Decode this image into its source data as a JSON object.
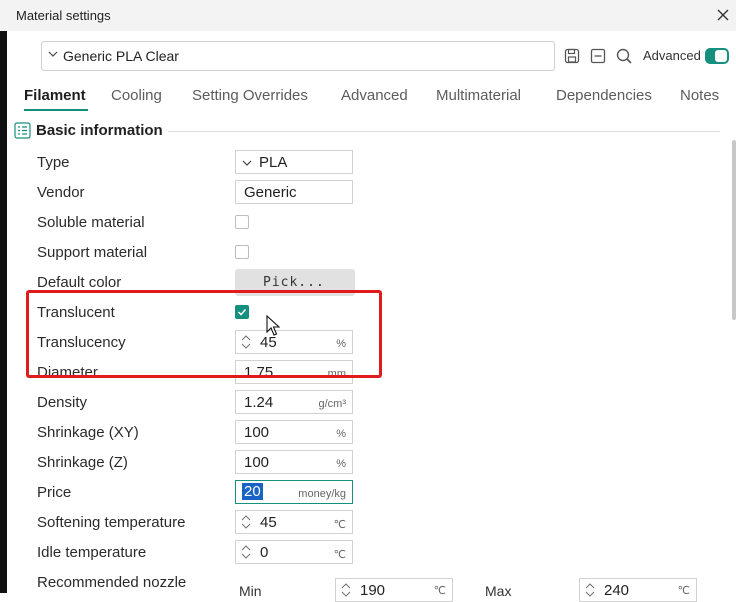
{
  "window": {
    "title": "Material settings"
  },
  "preset": {
    "name": "Generic PLA Clear"
  },
  "toolbar": {
    "advanced_label": "Advanced",
    "advanced_on": true,
    "accent_color": "#16907e"
  },
  "tabs": [
    {
      "label": "Filament",
      "active": true
    },
    {
      "label": "Cooling"
    },
    {
      "label": "Setting Overrides"
    },
    {
      "label": "Advanced"
    },
    {
      "label": "Multimaterial"
    },
    {
      "label": "Dependencies"
    },
    {
      "label": "Notes"
    }
  ],
  "section": {
    "title": "Basic information"
  },
  "fields": {
    "type": {
      "label": "Type",
      "value": "PLA"
    },
    "vendor": {
      "label": "Vendor",
      "value": "Generic"
    },
    "soluble": {
      "label": "Soluble material",
      "checked": false
    },
    "support": {
      "label": "Support material",
      "checked": false
    },
    "default_color": {
      "label": "Default color",
      "button": "Pick..."
    },
    "translucent": {
      "label": "Translucent",
      "checked": true
    },
    "translucency": {
      "label": "Translucency",
      "value": "45",
      "unit": "%"
    },
    "diameter": {
      "label": "Diameter",
      "value": "1.75",
      "unit": "mm"
    },
    "density": {
      "label": "Density",
      "value": "1.24",
      "unit": "g/cm³"
    },
    "shrink_xy": {
      "label": "Shrinkage (XY)",
      "value": "100",
      "unit": "%"
    },
    "shrink_z": {
      "label": "Shrinkage (Z)",
      "value": "100",
      "unit": "%"
    },
    "price": {
      "label": "Price",
      "value": "20",
      "unit": "money/kg"
    },
    "softening": {
      "label": "Softening temperature",
      "value": "45",
      "unit": "℃"
    },
    "idle": {
      "label": "Idle temperature",
      "value": "0",
      "unit": "℃"
    },
    "nozzle": {
      "label": "Recommended nozzle",
      "min_label": "Min",
      "min_value": "190",
      "max_label": "Max",
      "max_value": "240",
      "unit": "℃"
    }
  }
}
